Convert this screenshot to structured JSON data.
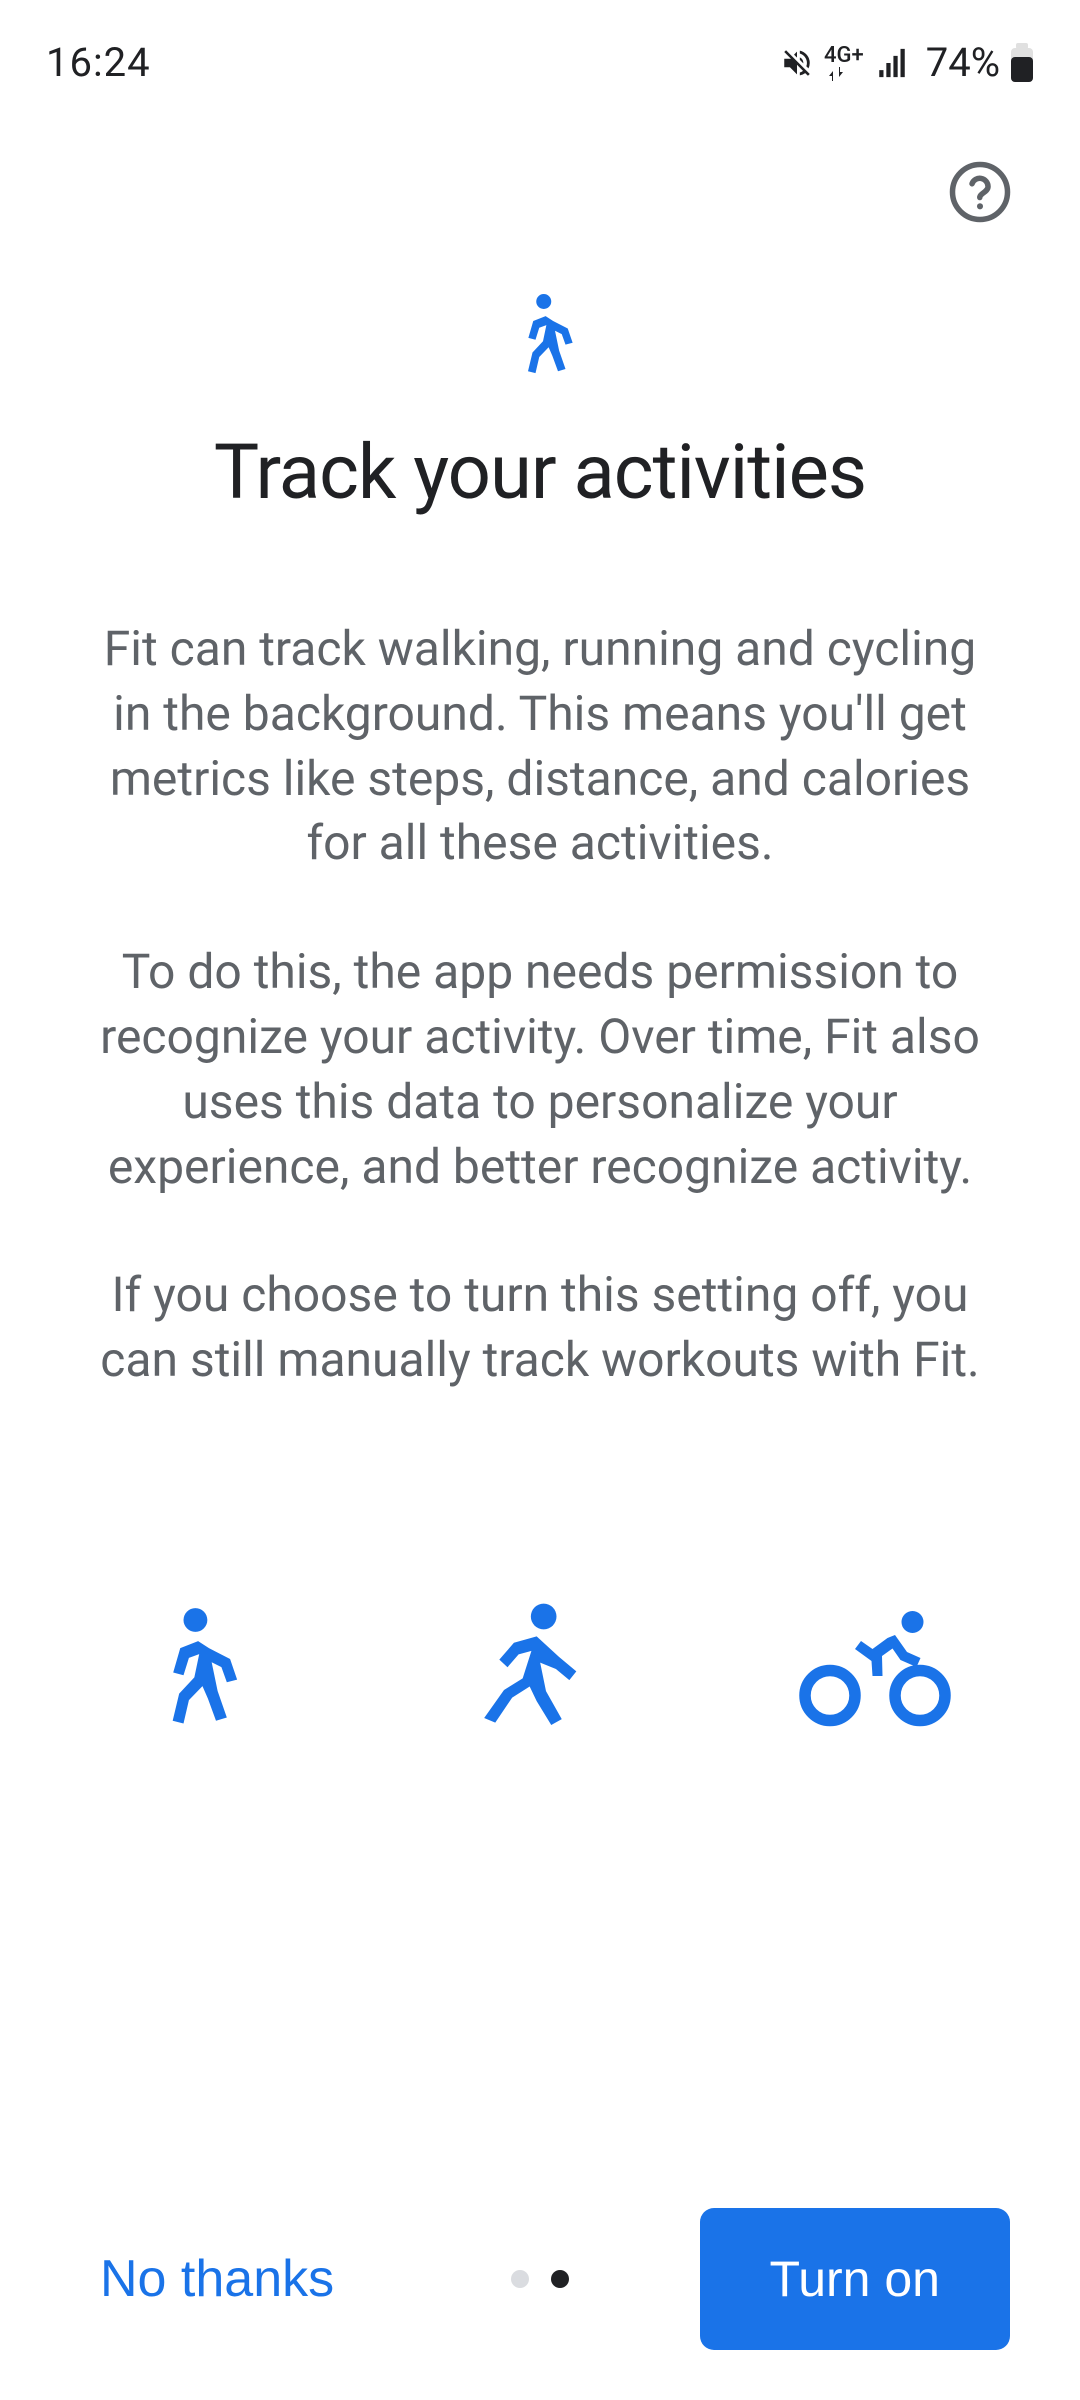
{
  "status": {
    "time": "16:24",
    "network_label": "4G+",
    "battery": "74%"
  },
  "page": {
    "title": "Track your activities",
    "paragraph1": "Fit can track walking, running and cycling in the background. This means you'll get metrics like steps, distance, and calories for all these activities.",
    "paragraph2": "To do this, the app needs permission to recognize your activity. Over time, Fit also uses this data to personalize your experience, and better recognize activity.",
    "paragraph3": "If you choose to turn this setting off, you can still manually track workouts with Fit."
  },
  "icons": {
    "hero": "walking-icon",
    "activities": [
      "walking-icon",
      "running-icon",
      "cycling-icon"
    ]
  },
  "colors": {
    "accent": "#1a73e8",
    "text_primary": "#202124",
    "text_secondary": "#5f6368"
  },
  "footer": {
    "secondary_label": "No thanks",
    "primary_label": "Turn on",
    "page_indicator": {
      "total": 2,
      "active_index": 1
    }
  }
}
